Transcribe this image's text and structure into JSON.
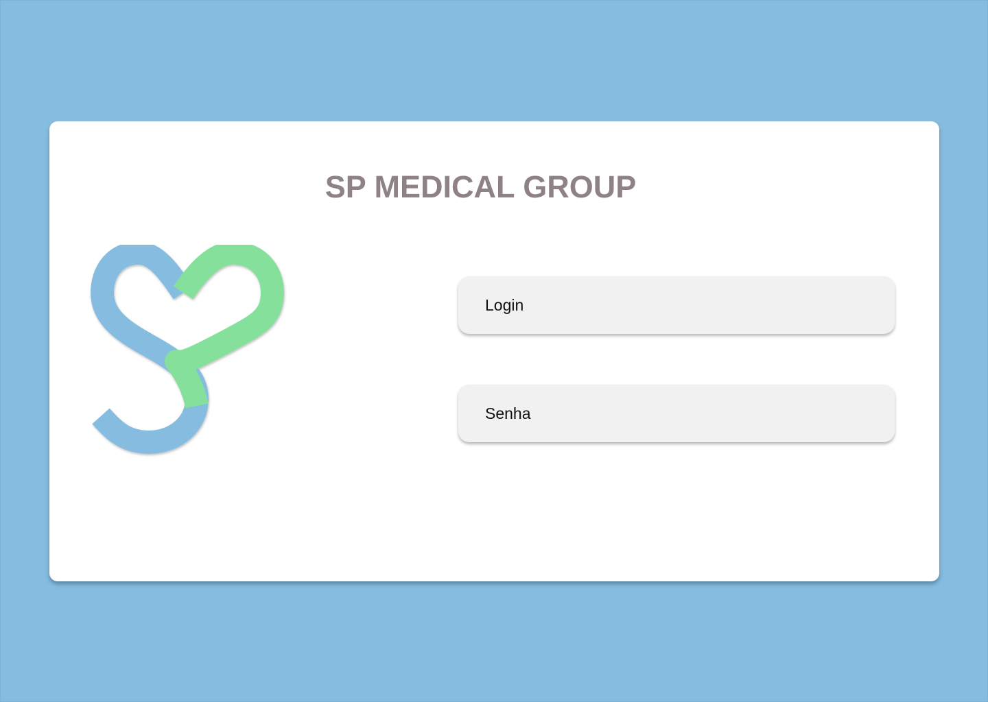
{
  "app": {
    "title": "SP MEDICAL GROUP"
  },
  "logo": {
    "icon": "sp-heart-logo-icon",
    "colors": {
      "blue": "#86BCDF",
      "green": "#84E09A"
    }
  },
  "form": {
    "login": {
      "value": "",
      "placeholder": "Login"
    },
    "senha": {
      "value": "",
      "placeholder": "Senha"
    }
  },
  "colors": {
    "background": "#86BCDF",
    "card": "#FFFFFF",
    "title": "#8E8284",
    "field": "#F1F1F1"
  }
}
